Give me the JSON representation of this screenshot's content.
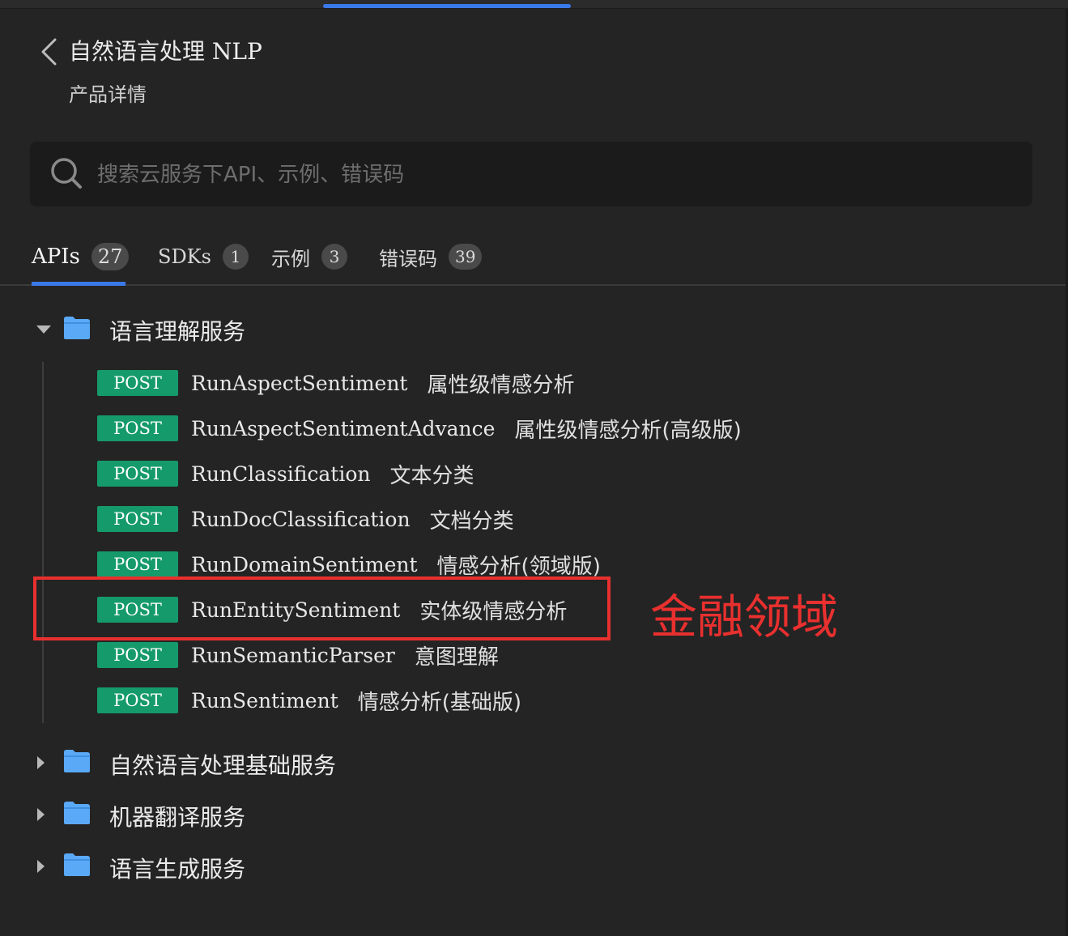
{
  "header": {
    "title": "自然语言处理 NLP",
    "subtitle": "产品详情"
  },
  "search": {
    "placeholder": "搜索云服务下API、示例、错误码",
    "value": ""
  },
  "tabs": [
    {
      "label": "APIs",
      "count": "27",
      "active": true
    },
    {
      "label": "SDKs",
      "count": "1",
      "active": false
    },
    {
      "label": "示例",
      "count": "3",
      "active": false
    },
    {
      "label": "错误码",
      "count": "39",
      "active": false
    }
  ],
  "groups": [
    {
      "label": "语言理解服务",
      "expanded": true,
      "apis": [
        {
          "method": "POST",
          "name": "RunAspectSentiment",
          "desc": "属性级情感分析"
        },
        {
          "method": "POST",
          "name": "RunAspectSentimentAdvance",
          "desc": "属性级情感分析(高级版)"
        },
        {
          "method": "POST",
          "name": "RunClassification",
          "desc": "文本分类"
        },
        {
          "method": "POST",
          "name": "RunDocClassification",
          "desc": "文档分类"
        },
        {
          "method": "POST",
          "name": "RunDomainSentiment",
          "desc": "情感分析(领域版)"
        },
        {
          "method": "POST",
          "name": "RunEntitySentiment",
          "desc": "实体级情感分析"
        },
        {
          "method": "POST",
          "name": "RunSemanticParser",
          "desc": "意图理解"
        },
        {
          "method": "POST",
          "name": "RunSentiment",
          "desc": "情感分析(基础版)"
        }
      ]
    },
    {
      "label": "自然语言处理基础服务",
      "expanded": false
    },
    {
      "label": "机器翻译服务",
      "expanded": false
    },
    {
      "label": "语言生成服务",
      "expanded": false
    }
  ],
  "annotation": {
    "text": "金融领域",
    "color": "#e8302f"
  },
  "colors": {
    "accent": "#3a79e8",
    "post_badge": "#159a6c",
    "folder": "#5aa9f6",
    "highlight": "#e8302f"
  }
}
